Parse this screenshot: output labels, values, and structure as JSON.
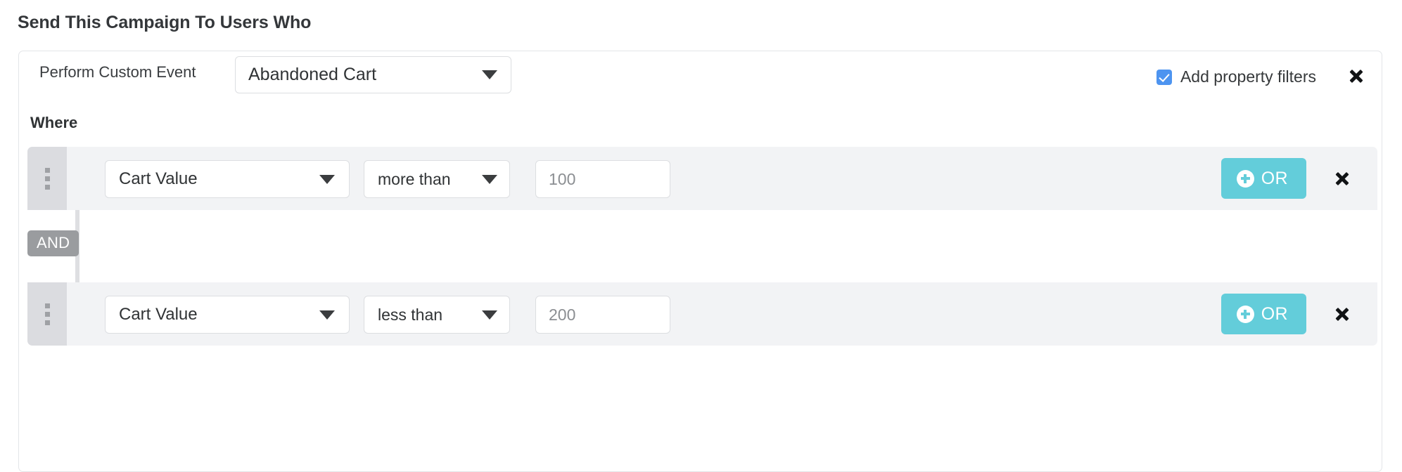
{
  "page": {
    "heading": "Send This Campaign To Users Who"
  },
  "colors": {
    "accent_or": "#63cdda",
    "checkbox_blue": "#4d94f0",
    "and_badge_gray": "#9a9c9f",
    "row_band": "#f2f3f5",
    "drag_col": "#dbdce0"
  },
  "event": {
    "label": "Perform Custom Event",
    "selected": "Abandoned Cart",
    "caret_icon": "chevron-down-icon",
    "filters_checkbox_checked": true,
    "filters_label": "Add property filters",
    "close_icon": "close-icon"
  },
  "where": {
    "label": "Where",
    "joiner": "AND",
    "conditions": [
      {
        "drag_icon": "drag-handle-icon",
        "property": "Cart Value",
        "operator": "more than",
        "value": "",
        "value_placeholder": "100",
        "or_label": "OR",
        "or_icon": "plus-circle-icon",
        "close_icon": "close-icon"
      },
      {
        "drag_icon": "drag-handle-icon",
        "property": "Cart Value",
        "operator": "less than",
        "value": "",
        "value_placeholder": "200",
        "or_label": "OR",
        "or_icon": "plus-circle-icon",
        "close_icon": "close-icon"
      }
    ]
  }
}
